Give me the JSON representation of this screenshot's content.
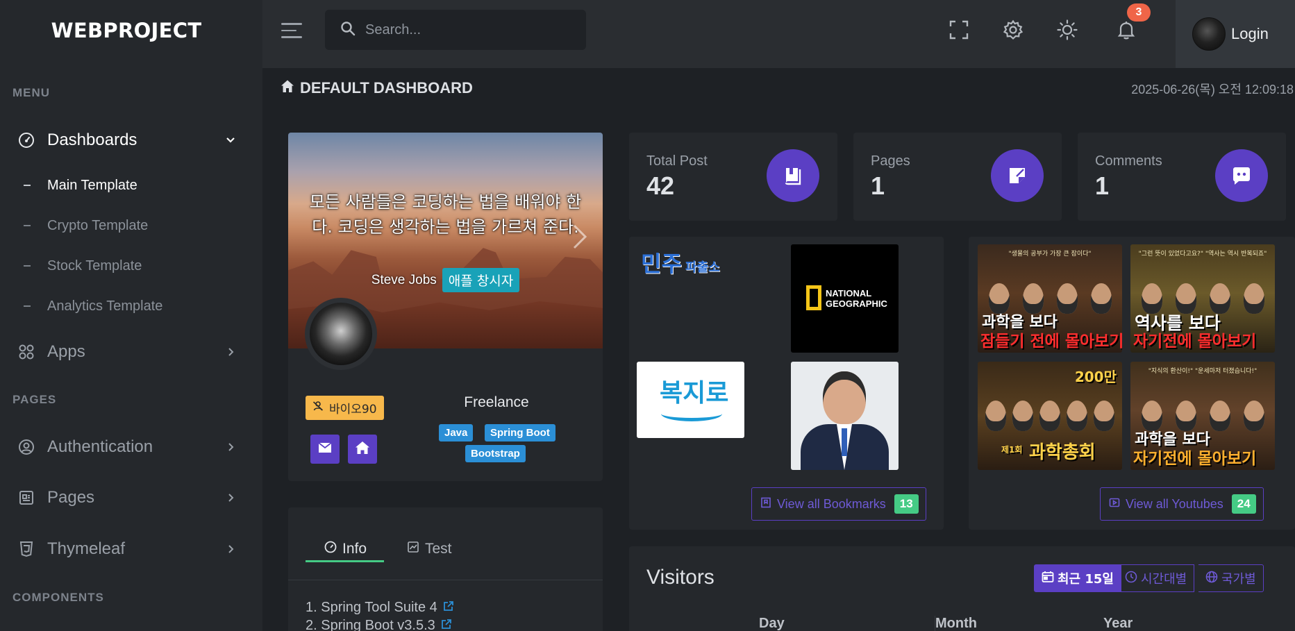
{
  "brand": "WEBPROJECT",
  "sidebar": {
    "menu_label": "MENU",
    "pages_label": "PAGES",
    "components_label": "COMPONENTS",
    "dashboards": "Dashboards",
    "sub_items": [
      "Main Template",
      "Crypto Template",
      "Stock Template",
      "Analytics Template"
    ],
    "apps": "Apps",
    "authentication": "Authentication",
    "pages": "Pages",
    "thymeleaf": "Thymeleaf"
  },
  "topbar": {
    "search_placeholder": "Search...",
    "notification_count": "3",
    "login_label": "Login"
  },
  "breadcrumb": {
    "title": "DEFAULT DASHBOARD",
    "datetime": "2025-06-26(목) 오전 12:09:18"
  },
  "profile": {
    "quote": "모든 사람들은 코딩하는 법을 배워야 한다. 코딩은 생각하는 법을 가르쳐 준다.",
    "author": "Steve Jobs",
    "author_tag": "애플 창시자",
    "bio_badge": "바이오90",
    "role": "Freelance",
    "tags": [
      "Java",
      "Spring Boot",
      "Bootstrap"
    ]
  },
  "info": {
    "tabs": [
      "Info",
      "Test"
    ],
    "lines": [
      "1. Spring Tool Suite 4",
      "2. Spring Boot v3.5.3"
    ]
  },
  "stats": [
    {
      "label": "Total Post",
      "value": "42",
      "icon": "book-icon"
    },
    {
      "label": "Pages",
      "value": "1",
      "icon": "note-icon"
    },
    {
      "label": "Comments",
      "value": "1",
      "icon": "chat-icon"
    }
  ],
  "bookmarks": {
    "tiles": {
      "minju_main": "민주",
      "minju_sub": "파출소",
      "natgeo_line1": "NATIONAL",
      "natgeo_line2": "GEOGRAPHIC",
      "bokji": "복지로"
    },
    "view_label": "View all Bookmarks",
    "count": "13"
  },
  "youtube": {
    "thumbs": [
      {
        "top": "\"생물의 공부가 가장 큰 잠이다\"",
        "line1": "과학을 보다",
        "line2": "잠들기 전에 몰아보기"
      },
      {
        "top": "\"그런 뜻이 있었다고요?\" \"역사는 역시 반복되죠\"",
        "line1": "역사를 보다",
        "line2": "자기전에 몰아보기"
      },
      {
        "top": "200만",
        "line1": "제1회",
        "line2": "과학총회"
      },
      {
        "top": "\"지식의 환산이!\" \"운세마저 터졌습니다!\"",
        "line1": "과학을 보다",
        "line2": "자기전에 몰아보기"
      }
    ],
    "view_label": "View all Youtubes",
    "count": "24"
  },
  "visitors": {
    "title": "Visitors",
    "segments": [
      "최근 15일",
      "시간대별",
      "국가별"
    ],
    "columns": [
      "Day",
      "Month",
      "Year"
    ]
  },
  "colors": {
    "accent": "#5b3fc4",
    "success": "#45cb85",
    "warning": "#f7b84b",
    "danger": "#f06548",
    "info": "#2b8fd6"
  }
}
